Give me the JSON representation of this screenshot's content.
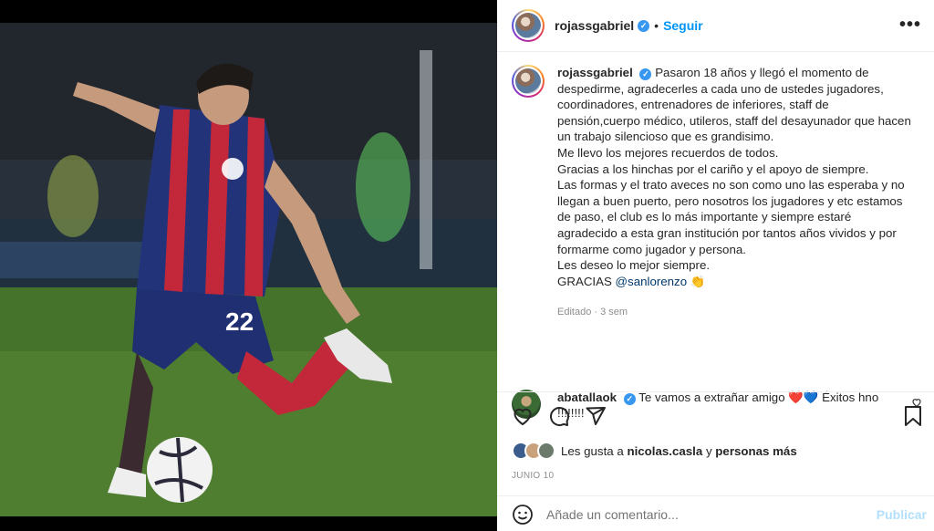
{
  "post": {
    "username": "rojassgabriel",
    "verified_mark": "✓",
    "dot": "•",
    "follow_label": "Seguir",
    "more_label": "•••",
    "caption": {
      "username": "rojassgabriel",
      "lines": [
        "Pasaron 18 años y llegó el momento de despedirme, agradecerles a cada uno de ustedes jugadores, coordinadores, entrenadores de inferiores, staff de pensión,cuerpo médico, utileros, staff del desayunador que hacen un trabajo silencioso que es grandisimo.",
        "Me llevo los mejores recuerdos de todos.",
        "Gracias a los hinchas por el cariño y el apoyo de siempre.",
        "Las formas y el trato aveces no son como uno las esperaba y no llegan a buen puerto, pero nosotros los jugadores y etc estamos de paso, el club es lo más importante y siempre estaré agradecido a esta gran institución por tantos años vividos y por formarme como jugador y persona.",
        "Les deseo lo mejor siempre."
      ],
      "thanks_prefix": "GRACIAS ",
      "thanks_mention": "@sanlorenzo",
      "thanks_emoji": "👏",
      "time": "Editado · 3 sem"
    },
    "comment": {
      "username": "abatallaok",
      "text": "Te vamos a extrañar amigo",
      "emoji": "❤️💙",
      "text_end": "Éxitos hno !!!!!!!!"
    },
    "likes": {
      "prefix": "Les gusta a ",
      "user": "nicolas.casla",
      "middle": " y ",
      "others": "personas más"
    },
    "date": "JUNIO 10",
    "add_comment": {
      "placeholder": "Añade un comentario...",
      "publish_label": "Publicar"
    },
    "photo": {
      "jersey_number": "22"
    }
  },
  "colors": {
    "link": "#0095f6",
    "mention": "#00376b",
    "verified": "#3897f0",
    "muted": "#8e8e8e",
    "jersey_red": "#c2283a",
    "jersey_blue": "#23337a"
  }
}
